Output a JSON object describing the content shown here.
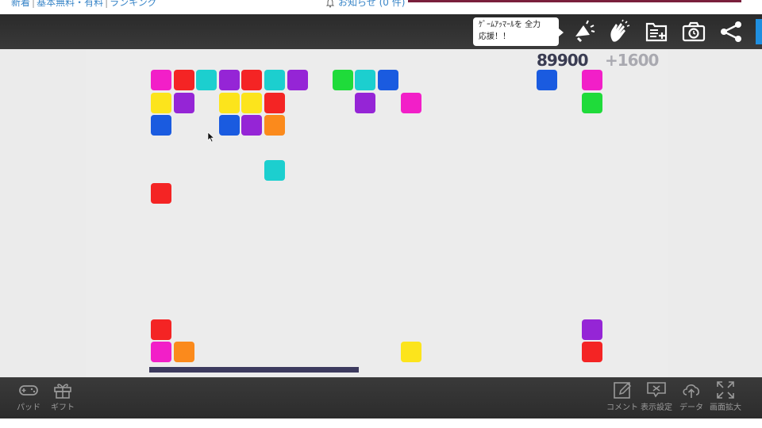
{
  "topnav": {
    "links": [
      "新着",
      "基本無料・有料",
      "ランキング"
    ],
    "notice": "お知らせ (0 件)"
  },
  "toolbar": {
    "bubble_line1": "ｹﾞｰﾑｱｯﾏｰﾙを 全力",
    "bubble_line2": "応援！！",
    "icons": [
      "cheer-icon",
      "clap-icon",
      "add-list-icon",
      "screenshot-icon",
      "share-icon"
    ]
  },
  "game": {
    "score": "89900",
    "bonus": "+1600",
    "colors": {
      "magenta": "#f21fc8",
      "red": "#f42424",
      "cyan": "#1ccfcf",
      "purple": "#9525d6",
      "green": "#1fdb3a",
      "blue": "#1a5be0",
      "yellow": "#fce41c",
      "orange": "#fb8a1c",
      "paddle": "#3c3a5e"
    },
    "grid_rows": 14,
    "grid_cols": 20,
    "blocks": [
      {
        "row": 0,
        "col": 0,
        "color": "magenta"
      },
      {
        "row": 0,
        "col": 1,
        "color": "red"
      },
      {
        "row": 0,
        "col": 2,
        "color": "cyan"
      },
      {
        "row": 0,
        "col": 3,
        "color": "purple"
      },
      {
        "row": 0,
        "col": 4,
        "color": "red"
      },
      {
        "row": 0,
        "col": 5,
        "color": "cyan"
      },
      {
        "row": 0,
        "col": 6,
        "color": "purple"
      },
      {
        "row": 0,
        "col": 8,
        "color": "green"
      },
      {
        "row": 0,
        "col": 9,
        "color": "cyan"
      },
      {
        "row": 0,
        "col": 10,
        "color": "blue"
      },
      {
        "row": 0,
        "col": 17,
        "color": "blue"
      },
      {
        "row": 0,
        "col": 19,
        "color": "magenta"
      },
      {
        "row": 1,
        "col": 0,
        "color": "yellow"
      },
      {
        "row": 1,
        "col": 1,
        "color": "purple"
      },
      {
        "row": 1,
        "col": 3,
        "color": "yellow"
      },
      {
        "row": 1,
        "col": 4,
        "color": "yellow"
      },
      {
        "row": 1,
        "col": 5,
        "color": "red"
      },
      {
        "row": 1,
        "col": 9,
        "color": "purple"
      },
      {
        "row": 1,
        "col": 11,
        "color": "magenta"
      },
      {
        "row": 1,
        "col": 19,
        "color": "green"
      },
      {
        "row": 2,
        "col": 0,
        "color": "blue"
      },
      {
        "row": 2,
        "col": 3,
        "color": "blue"
      },
      {
        "row": 2,
        "col": 4,
        "color": "purple"
      },
      {
        "row": 2,
        "col": 5,
        "color": "orange"
      },
      {
        "row": 4,
        "col": 5,
        "color": "cyan"
      },
      {
        "row": 5,
        "col": 0,
        "color": "red"
      },
      {
        "row": 11,
        "col": 0,
        "color": "red"
      },
      {
        "row": 11,
        "col": 19,
        "color": "purple"
      },
      {
        "row": 12,
        "col": 0,
        "color": "magenta"
      },
      {
        "row": 12,
        "col": 1,
        "color": "orange"
      },
      {
        "row": 12,
        "col": 11,
        "color": "yellow"
      },
      {
        "row": 12,
        "col": 19,
        "color": "red"
      }
    ],
    "timer_remaining_fraction": 0.46
  },
  "bottombar": {
    "pad": "パッド",
    "gift": "ギフト",
    "comment": "コメント",
    "display_settings": "表示設定",
    "data": "データ",
    "fullscreen": "画面拡大"
  }
}
